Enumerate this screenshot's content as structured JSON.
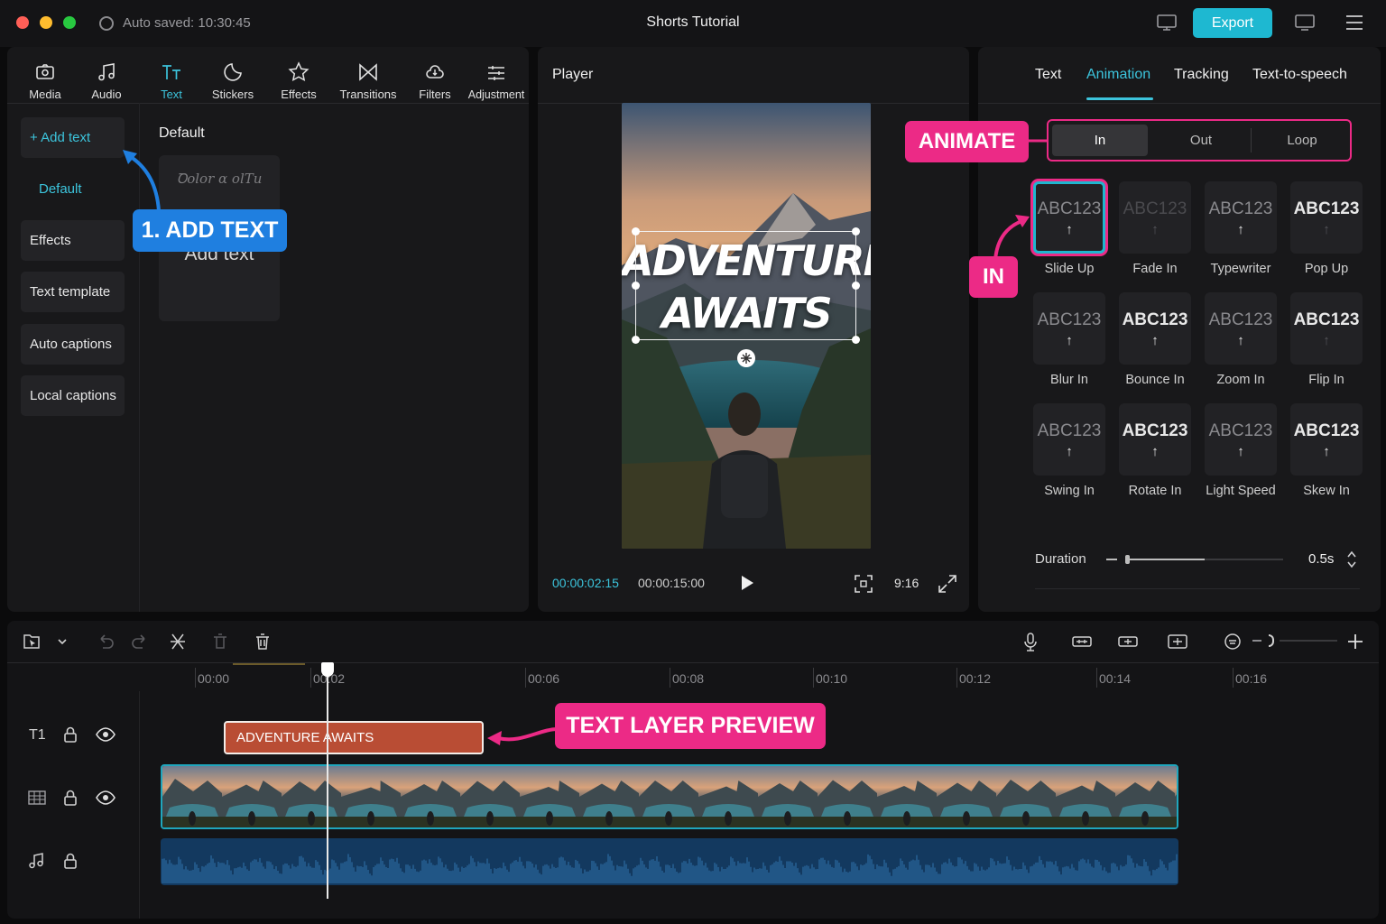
{
  "window": {
    "autosave": "Auto saved: 10:30:45",
    "title": "Shorts Tutorial",
    "export_label": "Export"
  },
  "toolbar": [
    {
      "label": "Media",
      "icon": "media-icon"
    },
    {
      "label": "Audio",
      "icon": "music-note-icon"
    },
    {
      "label": "Text",
      "icon": "text-tt-icon",
      "active": true
    },
    {
      "label": "Stickers",
      "icon": "sticker-icon"
    },
    {
      "label": "Effects",
      "icon": "star-icon"
    },
    {
      "label": "Transitions",
      "icon": "bowtie-icon"
    },
    {
      "label": "Filters",
      "icon": "filter-icon"
    },
    {
      "label": "Adjustment",
      "icon": "sliders-icon"
    }
  ],
  "sidebar": {
    "add_text": "+ Add text",
    "items": [
      "Default",
      "Effects",
      "Text template",
      "Auto captions",
      "Local captions"
    ]
  },
  "library": {
    "heading": "Default",
    "card_scrawl": "Ꝺolor ɑ olTu",
    "card_label": "Add text"
  },
  "callouts": {
    "add_text": "1. ADD TEXT",
    "animate": "ANIMATE",
    "in": "IN",
    "text_layer": "TEXT LAYER PREVIEW"
  },
  "player": {
    "title": "Player",
    "overlay_line1": "ADVENTURE",
    "overlay_line2": "AWAITS",
    "current_time": "00:00:02:15",
    "total_time": "00:00:15:00",
    "aspect": "9:16"
  },
  "inspector": {
    "tabs": [
      "Text",
      "Animation",
      "Tracking",
      "Text-to-speech"
    ],
    "active_tab": "Animation",
    "segments": [
      "In",
      "Out",
      "Loop"
    ],
    "active_segment": "In",
    "presets": [
      {
        "sample": "ABC123",
        "label": "Slide Up",
        "style": "dim",
        "selected": true
      },
      {
        "sample": "ABC123",
        "label": "Fade In",
        "style": "faint"
      },
      {
        "sample": "ABC123",
        "label": "Typewriter",
        "style": "dim"
      },
      {
        "sample": "ABC123",
        "label": "Pop Up",
        "style": "bright"
      },
      {
        "sample": "ABC123",
        "label": "Blur In",
        "style": "dim"
      },
      {
        "sample": "ABC123",
        "label": "Bounce In",
        "style": "bright"
      },
      {
        "sample": "ABC123",
        "label": "Zoom In",
        "style": "dim"
      },
      {
        "sample": "ABC123",
        "label": "Flip In",
        "style": "bright"
      },
      {
        "sample": "ABC123",
        "label": "Swing In",
        "style": "dim"
      },
      {
        "sample": "ABC123",
        "label": "Rotate In",
        "style": "bright"
      },
      {
        "sample": "ABC123",
        "label": "Light Speed",
        "style": "dim"
      },
      {
        "sample": "ABC123",
        "label": "Skew In",
        "style": "bright"
      }
    ],
    "duration_label": "Duration",
    "duration_value": "0.5s",
    "duration_fraction": 0.5
  },
  "timeline": {
    "ruler": [
      "00:00",
      "00:02",
      "00:06",
      "00:08",
      "00:10",
      "00:12",
      "00:14",
      "00:16"
    ],
    "text_clip": "ADVENTURE AWAITS",
    "track_text_label": "T1"
  },
  "colors": {
    "accent": "#1eb8d1",
    "callout_pink": "#ec2a86",
    "callout_blue": "#1f7fe0",
    "text_clip": "#b94d34"
  }
}
